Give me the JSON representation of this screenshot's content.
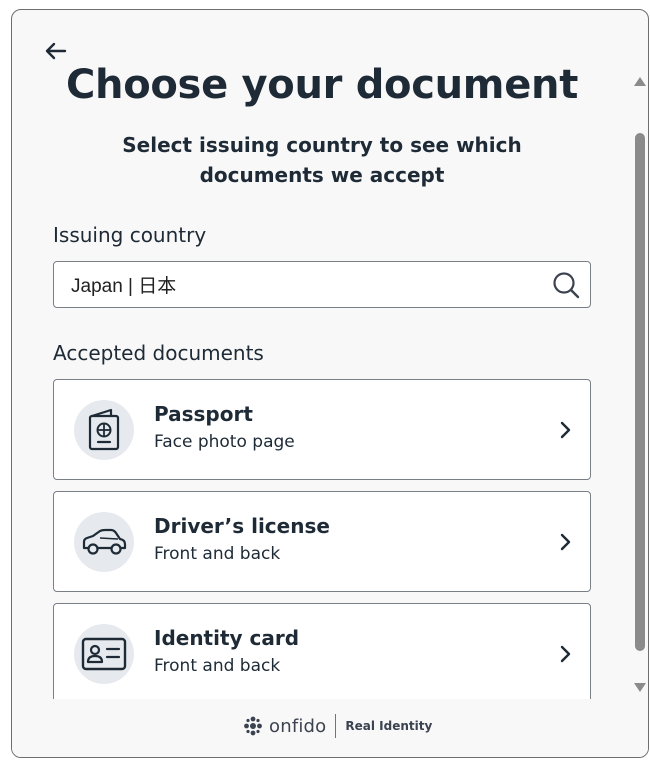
{
  "header": {
    "back_icon": "arrow-left-icon",
    "title": "Choose your document",
    "subtitle": "Select issuing country to see which documents we accept"
  },
  "country": {
    "label": "Issuing country",
    "value": "Japan | 日本",
    "search_icon": "search-icon"
  },
  "documents": {
    "label": "Accepted documents",
    "items": [
      {
        "title": "Passport",
        "subtitle": "Face photo page",
        "icon": "passport-icon"
      },
      {
        "title": "Driver’s license",
        "subtitle": "Front and back",
        "icon": "car-icon"
      },
      {
        "title": "Identity card",
        "subtitle": "Front and back",
        "icon": "id-card-icon"
      }
    ]
  },
  "footer": {
    "brand": "onfido",
    "tagline": "Real Identity"
  },
  "colors": {
    "text": "#1e2a36",
    "icon_bg": "#e6eaee",
    "border": "#7a7f86",
    "scrollbar": "#8b8b8b"
  }
}
